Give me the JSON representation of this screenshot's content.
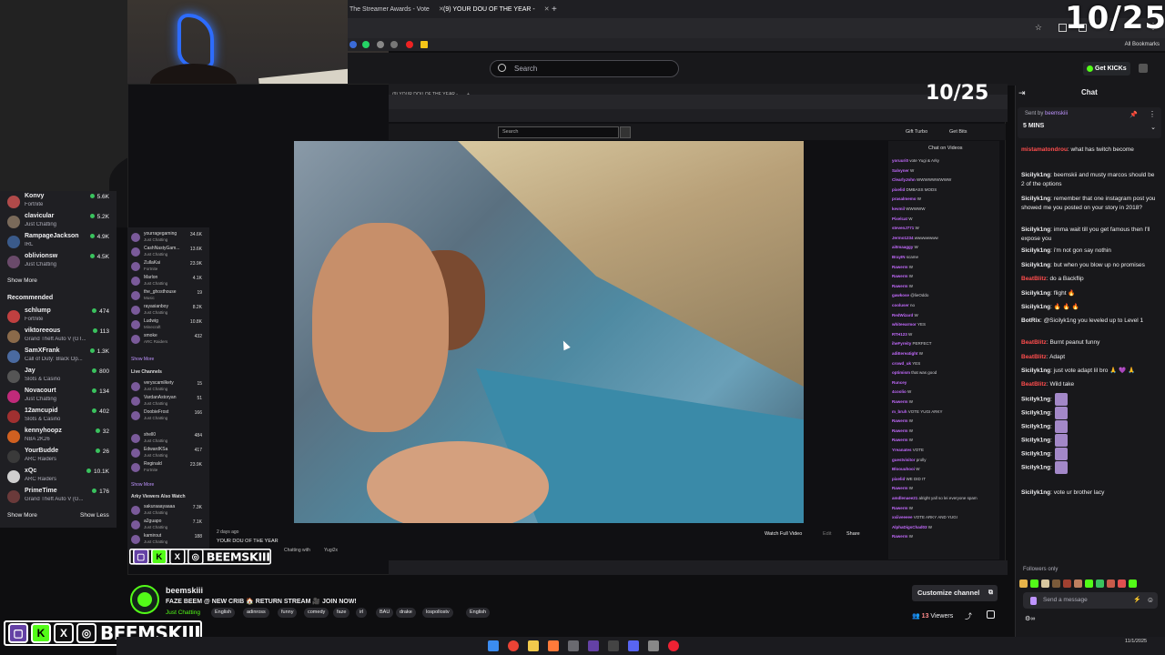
{
  "counter": "10/25",
  "browser": {
    "tabs": [
      {
        "label": "The Streamer Awards - Vote"
      },
      {
        "label": "(9) YOUR DOU OF THE YEAR -"
      }
    ],
    "all_bookmarks": "All Bookmarks"
  },
  "header": {
    "search_placeholder": "Search",
    "get_kicks": "Get KICKs"
  },
  "sidebar": {
    "following": [
      {
        "name": "Konvy",
        "game": "Fortnite",
        "viewers": "5.6K",
        "color": "#b04a4a"
      },
      {
        "name": "clavicular",
        "game": "Just Chatting",
        "viewers": "5.2K",
        "color": "#7a6a5a"
      },
      {
        "name": "RampageJackson",
        "game": "IRL",
        "viewers": "4.9K",
        "color": "#3a5a8a"
      },
      {
        "name": "oblivionsw",
        "game": "Just Chatting",
        "viewers": "4.5K",
        "color": "#6a4a6a"
      }
    ],
    "show_more_1": "Show More",
    "recommended_label": "Recommended",
    "recommended": [
      {
        "name": "schlump",
        "game": "Fortnite",
        "viewers": "474",
        "color": "#c04040"
      },
      {
        "name": "viktoreeous",
        "game": "Grand Theft Auto V (GT...",
        "viewers": "113",
        "color": "#8a6a4a"
      },
      {
        "name": "SamXFrank",
        "game": "Call of Duty: Black Op...",
        "viewers": "1.3K",
        "color": "#4a6aa0"
      },
      {
        "name": "Jay",
        "game": "Slots & Casino",
        "viewers": "800",
        "color": "#555"
      },
      {
        "name": "Novacourt",
        "game": "Just Chatting",
        "viewers": "134",
        "color": "#c02a7a"
      },
      {
        "name": "12amcupid",
        "game": "Slots & Casino",
        "viewers": "402",
        "color": "#a03030"
      },
      {
        "name": "kennyhoopz",
        "game": "NBA 2K26",
        "viewers": "32",
        "color": "#d06020"
      },
      {
        "name": "YourBudde",
        "game": "ARC Raiders",
        "viewers": "26",
        "color": "#3a3a3a"
      },
      {
        "name": "xQc",
        "game": "ARC Raiders",
        "viewers": "10.1K",
        "color": "#cfcfcf"
      },
      {
        "name": "PrimeTime",
        "game": "Grand Theft Auto V (G...",
        "viewers": "176",
        "color": "#6a3a3a"
      }
    ],
    "show_more_2": "Show More",
    "show_less": "Show Less"
  },
  "inner": {
    "tab": "(9) YOUR DOU OF THE YEAR -",
    "search_placeholder": "Search",
    "gift_turbo": "Gift Turbo",
    "get_bits": "Get Bits",
    "chat_title": "Chat on Videos",
    "sidebar_channels": [
      {
        "name": "yourragegaming",
        "game": "Just Chatting",
        "viewers": "34.6K"
      },
      {
        "name": "CashNastyGam...",
        "game": "Just Chatting",
        "viewers": "13.6K"
      },
      {
        "name": "ZullaKai",
        "game": "Fortnite",
        "viewers": "23.9K"
      },
      {
        "name": "Marlon",
        "game": "Just Chatting",
        "viewers": "4.1K"
      },
      {
        "name": "the_ghosthouse",
        "game": "Music",
        "viewers": "19"
      },
      {
        "name": "rayasianboy",
        "game": "Just Chatting",
        "viewers": "8.2K"
      },
      {
        "name": "Ludwig",
        "game": "Minecraft",
        "viewers": "10.8K"
      },
      {
        "name": "smoke",
        "game": "ARC Raiders",
        "viewers": "432"
      }
    ],
    "show_more": "Show More",
    "live_label": "Live Channels",
    "live_channels": [
      {
        "name": "veryscamilkety",
        "game": "Just Chatting",
        "viewers": "15"
      },
      {
        "name": "VardanAstoryan",
        "game": "Just Chatting",
        "viewers": "51"
      },
      {
        "name": "DoobieFrost",
        "game": "Just Chatting",
        "viewers": "166"
      },
      {
        "name": "shell0",
        "game": "Just Chatting",
        "viewers": "484"
      },
      {
        "name": "EdwardKSa",
        "game": "Just Chatting",
        "viewers": "417"
      },
      {
        "name": "Reginald",
        "game": "Fortnite",
        "viewers": "23.9K"
      }
    ],
    "show_more_2": "Show More",
    "also_watch": "Arky Viewers Also Watch",
    "also_channels": [
      {
        "name": "sakuraaayaaaa",
        "game": "Just Chatting",
        "viewers": "7.3K"
      },
      {
        "name": "a2guapo",
        "game": "Just Chatting",
        "viewers": "7.1K"
      },
      {
        "name": "kamirout",
        "game": "Just Chatting",
        "viewers": "188"
      }
    ],
    "age": "2 days ago",
    "video_title": "YOUR DOU OF THE YEAR",
    "chatting_with": "Chatting with",
    "chatting_with_name": "Yugi2x",
    "watch_full": "Watch Full Video",
    "edit": "Edit",
    "share": "Share",
    "chat_lines": [
      {
        "user": "yoruuri0",
        "text": "vote Yugi & Arky"
      },
      {
        "user": "Salvyner",
        "text": "W"
      },
      {
        "user": "ClearlyJohn",
        "text": "WWWWWWWWW"
      },
      {
        "user": "pixelid",
        "text": "DMBASS MODS"
      },
      {
        "user": "prasalmemo",
        "text": "W"
      },
      {
        "user": "kevmil",
        "text": "WWWWW"
      },
      {
        "user": "Pixelcat",
        "text": "W"
      },
      {
        "user": "stevenJ771",
        "text": "W"
      },
      {
        "user": "Jermo1234",
        "text": "wwwwwwww"
      },
      {
        "user": "ai0maaggy",
        "text": "W"
      },
      {
        "user": "BrayIN",
        "text": "scame"
      },
      {
        "user": "Rawerm",
        "text": "W"
      },
      {
        "user": "Rawerm",
        "text": "W"
      },
      {
        "user": "Rawerm",
        "text": "W"
      },
      {
        "user": "gawkose",
        "text": "@lieOddo"
      },
      {
        "user": "cooluser",
        "text": "no"
      },
      {
        "user": "RedWizard",
        "text": "W"
      },
      {
        "user": "whiteearmor",
        "text": "YES"
      },
      {
        "user": "RTH123",
        "text": "W"
      },
      {
        "user": "iheFyreity",
        "text": "PERFECT"
      },
      {
        "user": "adiEereatight",
        "text": "W"
      },
      {
        "user": "crowd_uk",
        "text": "YES"
      },
      {
        "user": "optimism",
        "text": "that was good"
      },
      {
        "user": "Runcey",
        "text": ""
      },
      {
        "user": "4coolio",
        "text": "W"
      },
      {
        "user": "Rawerm",
        "text": "W"
      },
      {
        "user": "m_bruh",
        "text": "VOTE YUGI ARKY"
      },
      {
        "user": "Rawerm",
        "text": "W"
      },
      {
        "user": "Rawerm",
        "text": "W"
      },
      {
        "user": "Rawerm",
        "text": "W"
      },
      {
        "user": "Yreanates",
        "text": "VOTE"
      },
      {
        "user": "guestvisitor",
        "text": "prolly"
      },
      {
        "user": "Bloouuhooi",
        "text": "W"
      },
      {
        "user": "pixelid",
        "text": "WE DID IT"
      },
      {
        "user": "Rawerm",
        "text": "W"
      },
      {
        "user": "amdlenaee21",
        "text": "alright yall so lei everyone spam"
      },
      {
        "user": "Rawerm",
        "text": "W"
      },
      {
        "user": "xxiiveeeee",
        "text": "VOTE ARKY AND YUGI"
      },
      {
        "user": "AlphaDigsChad03",
        "text": "W"
      },
      {
        "user": "Rawerm",
        "text": "W"
      }
    ]
  },
  "chat": {
    "title": "Chat",
    "sent_by_label": "Sent by",
    "sent_by": "beemskiii",
    "pinned_text": "5 MINS",
    "messages": [
      {
        "user": "mistamatondrou",
        "user_red": true,
        "text": "what has twitch become"
      },
      {
        "user": "Sicilyk1ng",
        "user_red": false,
        "text": "beemskii and musty marcos should be 2 of the options"
      },
      {
        "user": "Sicilyk1ng",
        "user_red": false,
        "text": "remember that one instagram post you showed me you posted on your story in 2018?"
      },
      {
        "user": "Sicilyk1ng",
        "user_red": false,
        "text": "imma wait till you get famous then I'll expose you"
      },
      {
        "user": "Sicilyk1ng",
        "user_red": false,
        "text": "i'm not gon say nothin"
      },
      {
        "user": "Sicilyk1ng",
        "user_red": false,
        "text": "but when you blow up no promises"
      },
      {
        "user": "BeatBlitz",
        "user_red": true,
        "text": "do a Backflip"
      },
      {
        "user": "Sicilyk1ng",
        "user_red": false,
        "text": "flight 🔥"
      },
      {
        "user": "Sicilyk1ng",
        "user_red": false,
        "text": "🔥 🔥 🔥"
      },
      {
        "user": "BotRix",
        "user_red": false,
        "text": "@Sicilyk1ng you leveled up to Level 1"
      },
      {
        "user": "BeatBlitz",
        "user_red": true,
        "text": "Burnt peanut funny"
      },
      {
        "user": "BeatBlitz",
        "user_red": true,
        "text": "Adapt"
      },
      {
        "user": "Sicilyk1ng",
        "user_red": false,
        "text": "just vote adapt lil bro 🙏 💜 🙏"
      },
      {
        "user": "BeatBlitz",
        "user_red": true,
        "text": "Wild take"
      }
    ],
    "emote_lines": [
      {
        "user": "Sicilyk1ng"
      },
      {
        "user": "Sicilyk1ng"
      },
      {
        "user": "Sicilyk1ng"
      },
      {
        "user": "Sicilyk1ng"
      },
      {
        "user": "Sicilyk1ng"
      },
      {
        "user": "Sicilyk1ng"
      }
    ],
    "last_message": {
      "user": "Sicilyk1ng",
      "text": "vote ur brother lacy"
    },
    "followers_only": "Followers only",
    "input_placeholder": "Send a message"
  },
  "stream": {
    "streamer": "beemskiii",
    "title": "FAZE BEEM @ NEW CRIB 🏠 RETURN STREAM 🎥 JOIN NOW!",
    "category": "Just Chatting",
    "tags": [
      "English",
      "adinross",
      "funny",
      "comedy",
      "faze",
      "irl",
      "BAU",
      "drake",
      "lospollostv",
      "English"
    ],
    "customize_label": "Customize channel",
    "viewers_count": "13",
    "viewers_label": "Viewers"
  },
  "overlay": {
    "handle": "BEEMSKIII",
    "icons": [
      "twitch",
      "kick",
      "x",
      "instagram"
    ]
  },
  "taskbar": {
    "time": "11/1/2025"
  },
  "colors": {
    "kick_green": "#53fc18",
    "chat_red": "#ff4d4d",
    "background": "#0e0e10"
  }
}
